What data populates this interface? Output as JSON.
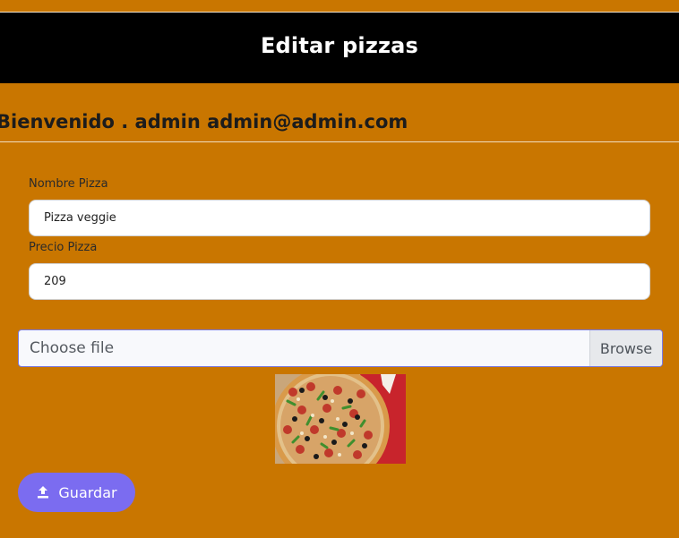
{
  "header": {
    "title": "Editar pizzas"
  },
  "welcome": {
    "text": "Bienvenido . admin admin@admin.com"
  },
  "form": {
    "name_label": "Nombre Pizza",
    "name_value": "Pizza veggie",
    "price_label": "Precio Pizza",
    "price_value": "209",
    "file_placeholder": "Choose file",
    "browse_label": "Browse",
    "save_label": "Guardar",
    "save_icon": "upload-icon"
  },
  "preview": {
    "image_description_icon": "pizza-image"
  },
  "colors": {
    "background": "#c97600",
    "header_bg": "#000000",
    "save_button": "#7b6cf0"
  }
}
